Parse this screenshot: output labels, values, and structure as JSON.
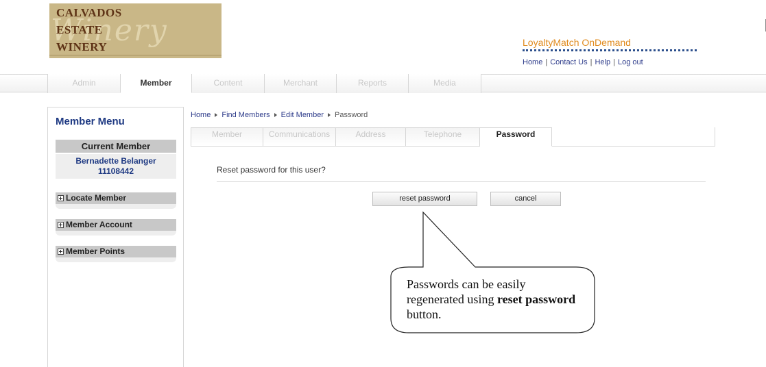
{
  "header": {
    "logo": {
      "line1": "CALVADOS",
      "line2": "ESTATE",
      "line3": "WINERY",
      "script": "Winery"
    },
    "brand": "LoyaltyMatch OnDemand",
    "links": [
      "Home",
      "Contact Us",
      "Help",
      "Log out"
    ]
  },
  "nav": {
    "tabs": [
      "Admin",
      "Member",
      "Content",
      "Merchant",
      "Reports",
      "Media"
    ],
    "active": "Member"
  },
  "sidebar": {
    "title": "Member Menu",
    "current_member_label": "Current Member",
    "member_name": "Bernadette Belanger",
    "member_id": "11108442",
    "sections": [
      "Locate Member",
      "Member Account",
      "Member Points"
    ]
  },
  "breadcrumb": [
    "Home",
    "Find Members",
    "Edit Member",
    "Password"
  ],
  "subtabs": {
    "tabs": [
      "Member",
      "Communications",
      "Address",
      "Telephone",
      "Password"
    ],
    "active": "Password"
  },
  "main": {
    "question": "Reset password for this user?",
    "reset_button": "reset password",
    "cancel_button": "cancel"
  },
  "callout": {
    "part1": "Passwords can be easily regenerated using ",
    "bold": "reset password",
    "part2": " button."
  },
  "colors": {
    "brand_orange": "#e08a1d",
    "link_blue": "#2d3b8a",
    "menu_blue": "#1f3a83",
    "logo_tan": "#c9b787",
    "logo_brown": "#5e3316"
  }
}
